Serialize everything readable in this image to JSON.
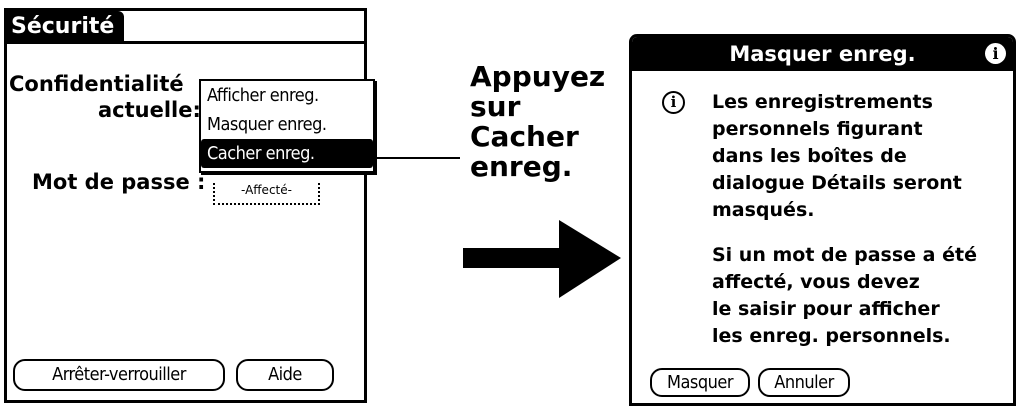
{
  "security_screen": {
    "title": "Sécurité",
    "privacy_label_line1": "Confidentialité",
    "privacy_label_line2": "actuelle:",
    "privacy_options": [
      "Afficher enreg.",
      "Masquer enreg.",
      "Cacher enreg."
    ],
    "selected_option_index": 2,
    "password_label": "Mot de passe :",
    "password_value": "-Affecté-",
    "lock_button": "Arrêter-verrouiller",
    "help_button": "Aide"
  },
  "callout": {
    "lines": [
      "Appuyez",
      "sur",
      "Cacher",
      "enreg."
    ]
  },
  "dialog": {
    "title": "Masquer enreg.",
    "message_paragraph1": [
      "Les enregistrements",
      "personnels figurant",
      "dans les boîtes de",
      "dialogue Détails seront",
      "masqués."
    ],
    "message_paragraph2": [
      "Si un mot de passe a été",
      "affecté, vous devez",
      "le saisir pour afficher",
      "les enreg. personnels."
    ],
    "hide_button": "Masquer",
    "cancel_button": "Annuler",
    "info_icon": "i"
  },
  "icons": {
    "title_info": "info-icon",
    "body_info": "info-icon",
    "arrow": "right-arrow-icon"
  }
}
